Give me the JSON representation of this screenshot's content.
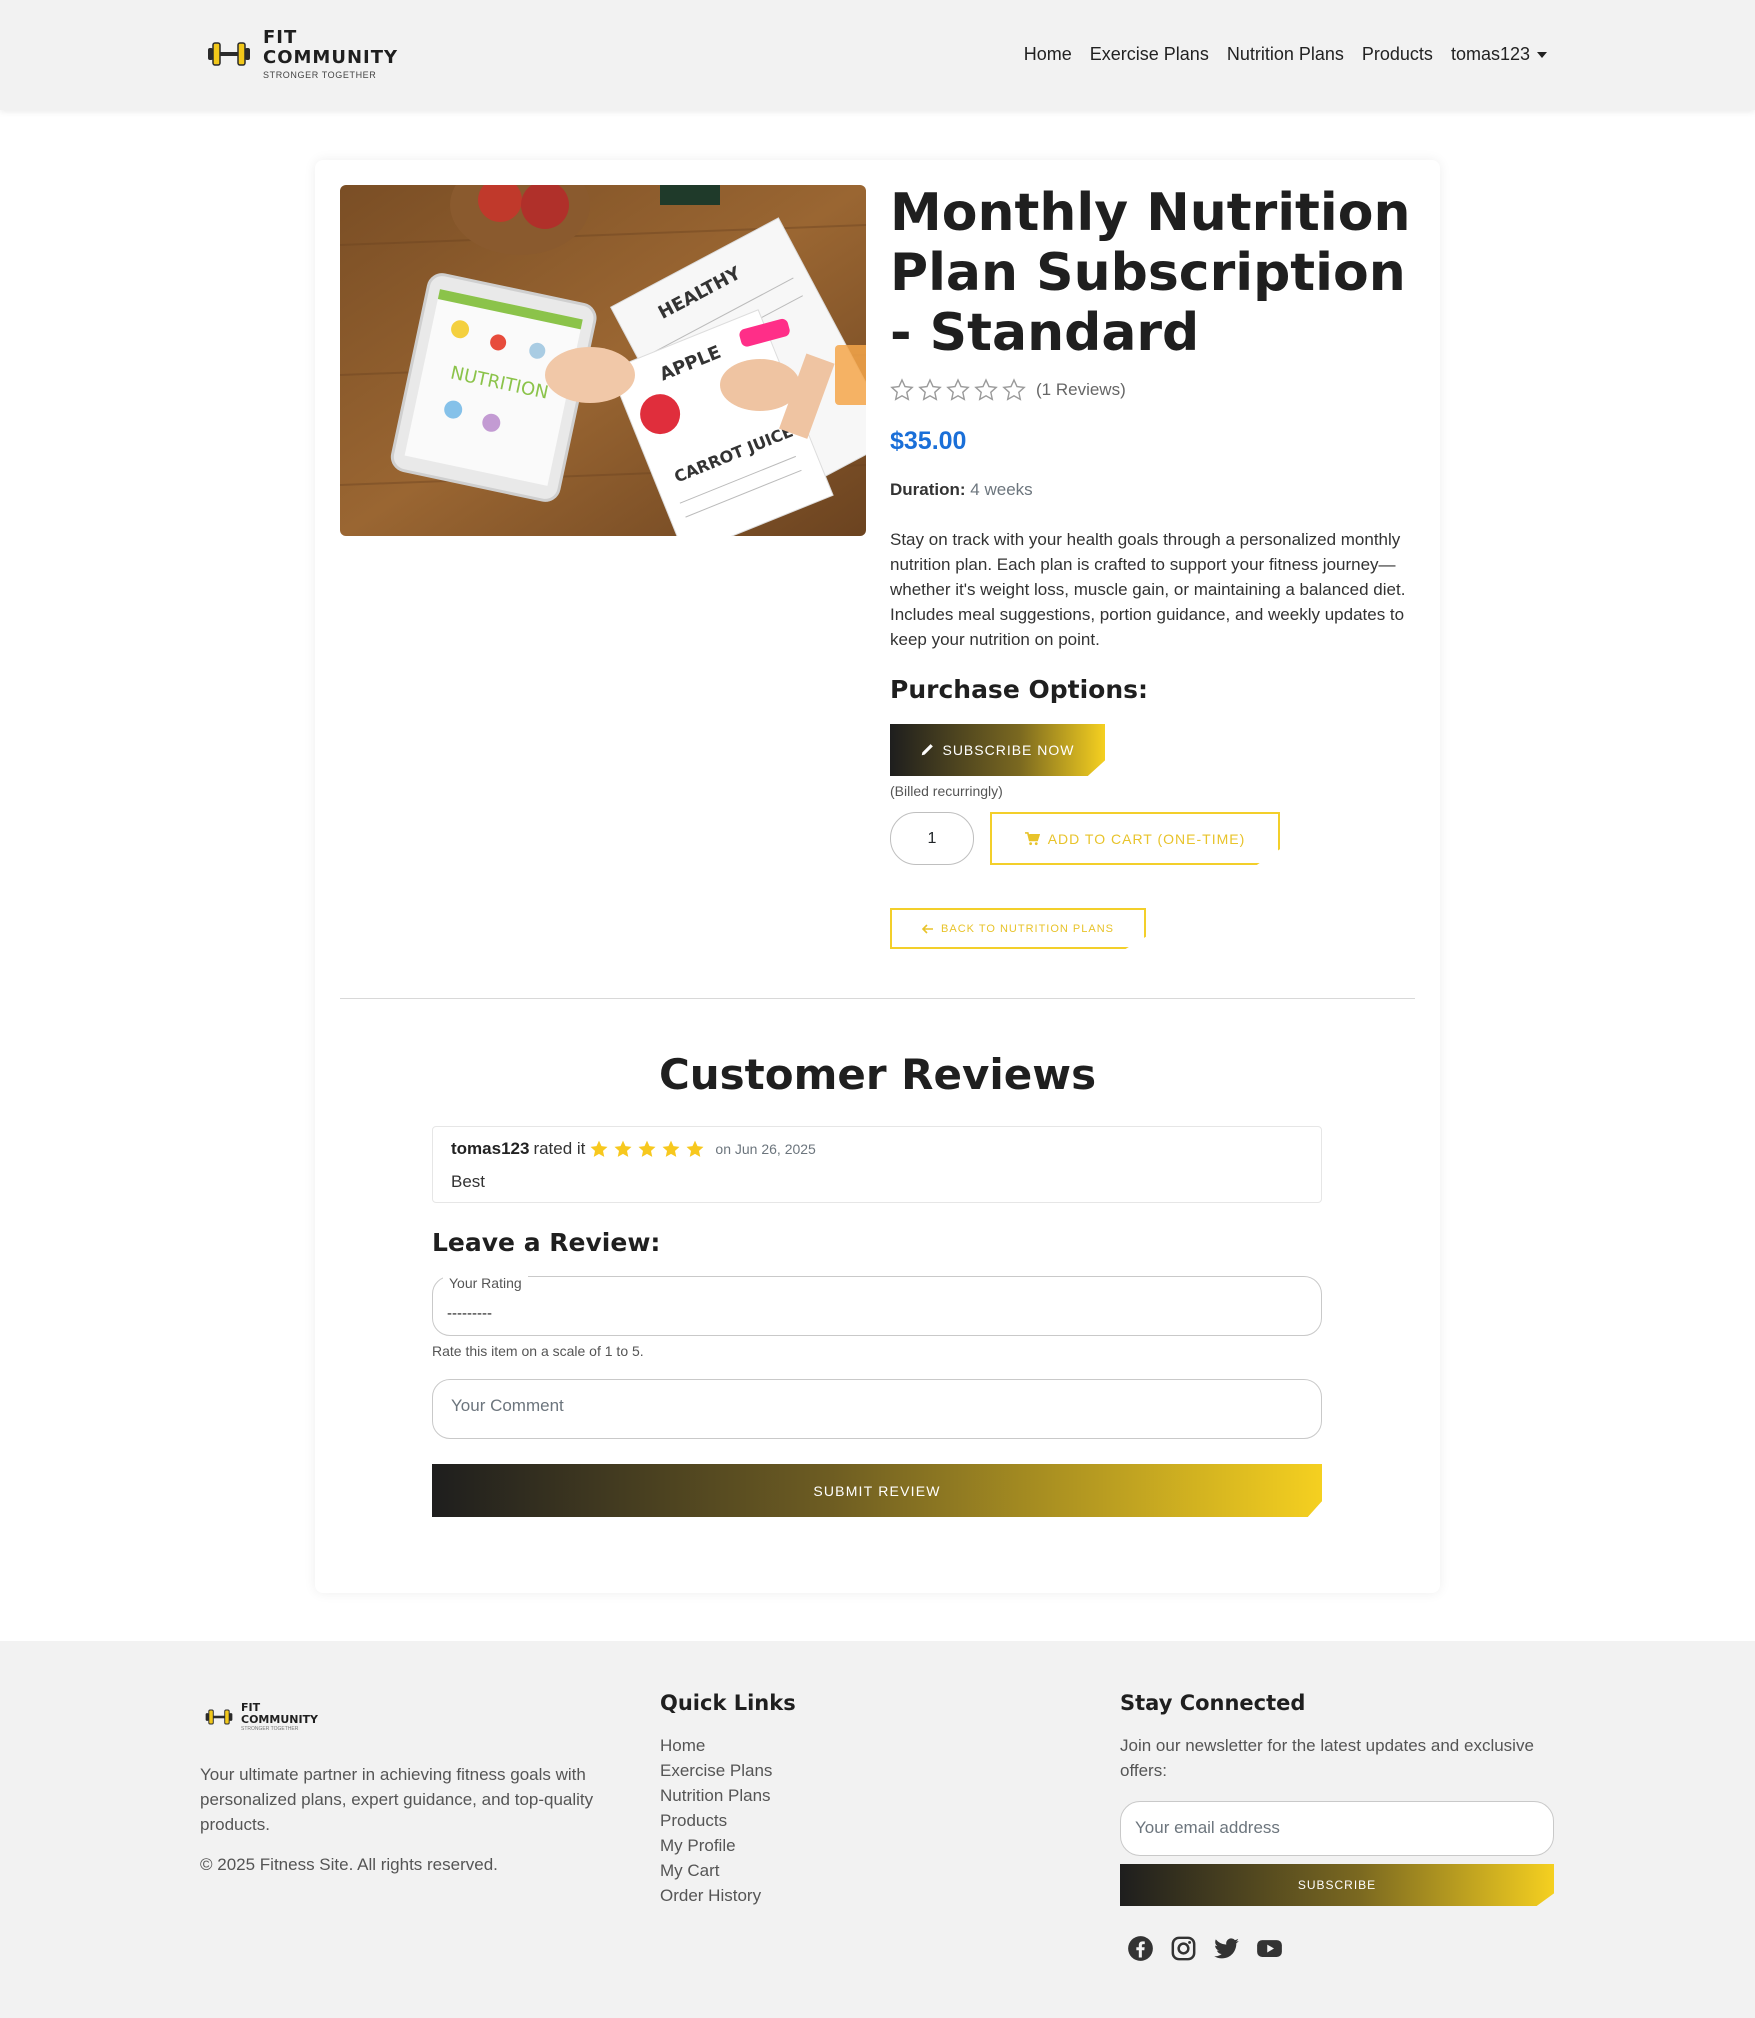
{
  "brand": {
    "line1": "FIT",
    "line2": "COMMUNITY",
    "tagline": "STRONGER TOGETHER",
    "accent": "#f5d020"
  },
  "nav": {
    "items": [
      "Home",
      "Exercise Plans",
      "Nutrition Plans",
      "Products"
    ],
    "user": "tomas123"
  },
  "product": {
    "image_icon": "nutrition-tablet-photo",
    "title": "Monthly Nutrition Plan Subscription - Standard",
    "rating_stars": 0,
    "reviews_count": "(1 Reviews)",
    "price": "$35.00",
    "duration_label": "Duration:",
    "duration_value": "4 weeks",
    "description": "Stay on track with your health goals through a personalized monthly nutrition plan. Each plan is crafted to support your fitness journey—whether it's weight loss, muscle gain, or maintaining a balanced diet. Includes meal suggestions, portion guidance, and weekly updates to keep your nutrition on point.",
    "price_color": "#1a6fd8"
  },
  "purchase": {
    "heading": "Purchase Options:",
    "subscribe_label": "SUBSCRIBE NOW",
    "billed_note": "(Billed recurringly)",
    "quantity": "1",
    "add_to_cart_label": "ADD TO CART (ONE-TIME)",
    "back_label": "BACK TO NUTRITION PLANS"
  },
  "reviews": {
    "heading": "Customer Reviews",
    "items": [
      {
        "user": "tomas123",
        "rated_text": "rated it",
        "stars": 5,
        "date": "on Jun 26, 2025",
        "comment": "Best"
      }
    ]
  },
  "review_form": {
    "heading": "Leave a Review:",
    "rating_label": "Your Rating",
    "rating_value": "---------",
    "help_text": "Rate this item on a scale of 1 to 5.",
    "comment_placeholder": "Your Comment",
    "submit_label": "SUBMIT REVIEW"
  },
  "footer": {
    "about": "Your ultimate partner in achieving fitness goals with personalized plans, expert guidance, and top-quality products.",
    "copyright": "© 2025 Fitness Site. All rights reserved.",
    "quick_links_heading": "Quick Links",
    "links": [
      "Home",
      "Exercise Plans",
      "Nutrition Plans",
      "Products",
      "My Profile",
      "My Cart",
      "Order History"
    ],
    "connected_heading": "Stay Connected",
    "newsletter_text": "Join our newsletter for the latest updates and exclusive offers:",
    "email_placeholder": "Your email address",
    "subscribe_label": "SUBSCRIBE",
    "social_icons": [
      "facebook-icon",
      "instagram-icon",
      "twitter-icon",
      "youtube-icon"
    ]
  }
}
